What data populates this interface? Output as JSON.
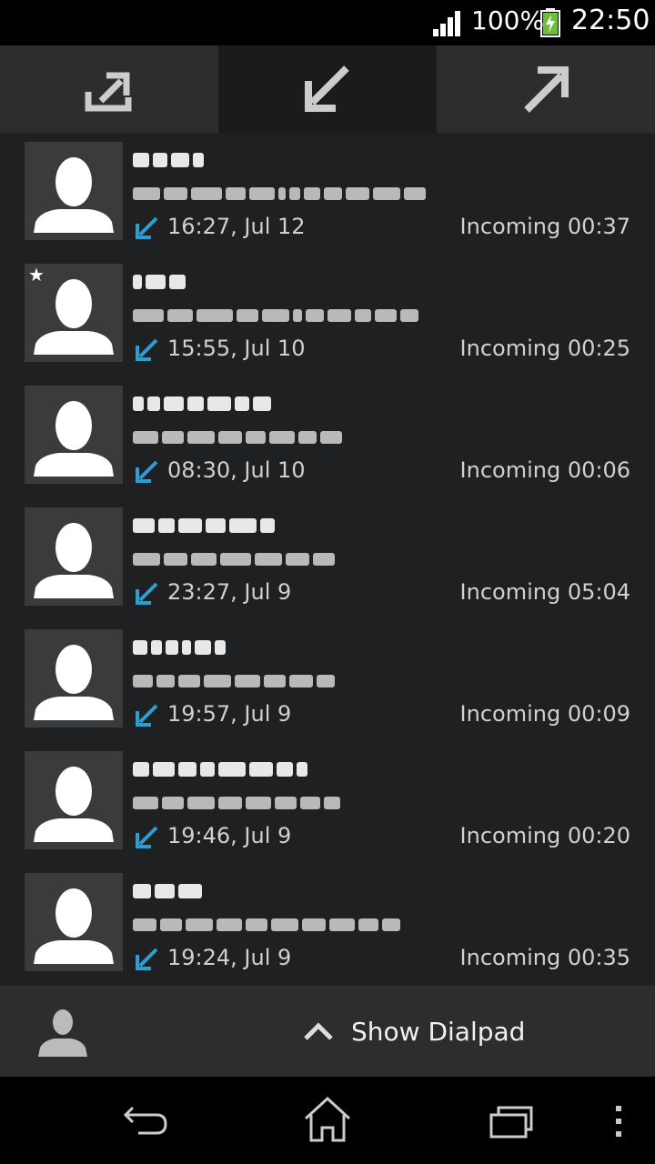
{
  "status_bar": {
    "battery_percent": "100%",
    "time": "22:50",
    "signal_icon": "signal-bars-icon",
    "battery_icon": "battery-charging-icon"
  },
  "tabs": [
    {
      "icon": "call-log-all-icon",
      "active": false
    },
    {
      "icon": "incoming-call-icon",
      "active": true
    },
    {
      "icon": "outgoing-call-icon",
      "active": false
    }
  ],
  "calls": [
    {
      "time": "16:27, Jul 12",
      "status": "Incoming 00:37",
      "starred": false
    },
    {
      "time": "15:55, Jul 10",
      "status": "Incoming 00:25",
      "starred": true
    },
    {
      "time": "08:30, Jul 10",
      "status": "Incoming 00:06",
      "starred": false
    },
    {
      "time": "23:27, Jul 9",
      "status": "Incoming 05:04",
      "starred": false
    },
    {
      "time": "19:57, Jul 9",
      "status": "Incoming 00:09",
      "starred": false
    },
    {
      "time": "19:46, Jul 9",
      "status": "Incoming 00:20",
      "starred": false
    },
    {
      "time": "19:24, Jul 9",
      "status": "Incoming 00:35",
      "starred": false
    }
  ],
  "bottom_bar": {
    "dialpad_label": "Show Dialpad"
  },
  "colors": {
    "accent_incoming": "#2a9fd6",
    "list_background": "#1f2021",
    "tab_background": "#2b2d2f",
    "tab_active_background": "#1a1b1c"
  }
}
